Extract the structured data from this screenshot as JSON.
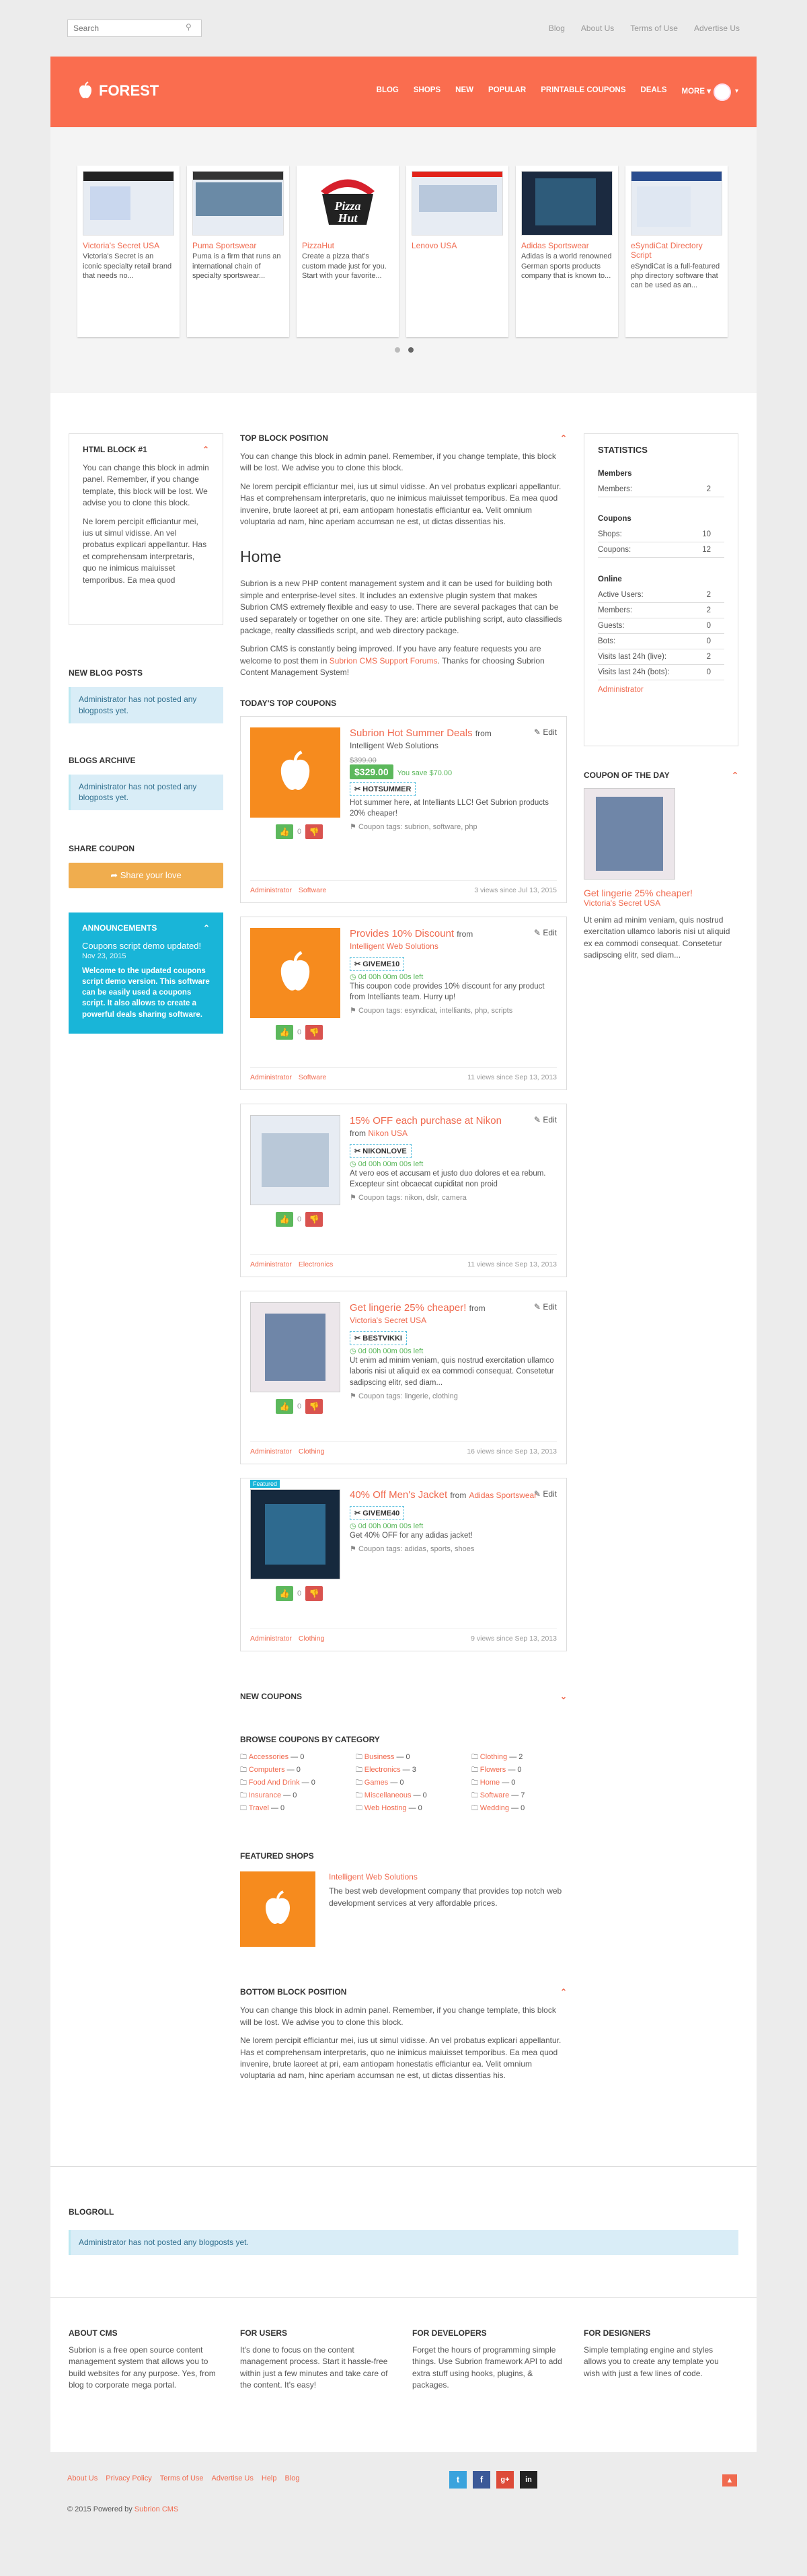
{
  "topbar": {
    "search_placeholder": "Search",
    "links": [
      "Blog",
      "About Us",
      "Terms of Use",
      "Advertise Us"
    ]
  },
  "header": {
    "logo": "FOREST",
    "nav": [
      "BLOG",
      "SHOPS",
      "NEW",
      "POPULAR",
      "PRINTABLE COUPONS",
      "DEALS",
      "MORE"
    ]
  },
  "carousel": {
    "cards": [
      {
        "title": "Victoria's Secret USA",
        "desc": "Victoria's Secret is an iconic specialty retail brand that needs no..."
      },
      {
        "title": "Puma Sportswear",
        "desc": "Puma is a firm that runs an international chain of specialty sportswear..."
      },
      {
        "title": "PizzaHut",
        "desc": "Create a pizza that's custom made just for you. Start with your favorite..."
      },
      {
        "title": "Lenovo USA",
        "desc": ""
      },
      {
        "title": "Adidas Sportswear",
        "desc": "Adidas is a world renowned German sports products company that is known to..."
      },
      {
        "title": "eSyndiCat Directory Script",
        "desc": "eSyndiCat is a full-featured php directory software that can be used as an..."
      }
    ]
  },
  "left": {
    "html_block_title": "HTML BLOCK #1",
    "html_block_p1": "You can change this block in admin panel. Remember, if you change template, this block will be lost. We advise you to clone this block.",
    "html_block_p2": "Ne lorem percipit efficiantur mei, ius ut simul vidisse. An vel probatus explicari appellantur. Has et comprehensam interpretaris, quo ne inimicus maiuisset temporibus. Ea mea quod",
    "new_blog_posts": "NEW BLOG POSTS",
    "no_posts": "Administrator has not posted any blogposts yet.",
    "blogs_archive": "BLOGS ARCHIVE",
    "share_coupon": "SHARE COUPON",
    "share_btn": "Share your love",
    "announcements": "ANNOUNCEMENTS",
    "ann_title": "Coupons script demo updated!",
    "ann_date": "Nov 23, 2015",
    "ann_body": "Welcome to the updated coupons script demo version. This software can be easily used a coupons script. It also allows to create a powerful deals sharing software."
  },
  "main": {
    "top_block_title": "TOP BLOCK POSITION",
    "top_block_p1": "You can change this block in admin panel. Remember, if you change template, this block will be lost. We advise you to clone this block.",
    "top_block_p2": "Ne lorem percipit efficiantur mei, ius ut simul vidisse. An vel probatus explicari appellantur. Has et comprehensam interpretaris, quo ne inimicus maiuisset temporibus. Ea mea quod invenire, brute laoreet at pri, eam antiopam honestatis efficiantur ea. Velit omnium voluptaria ad nam, hinc aperiam accumsan ne est, ut dictas dissentias his.",
    "home_title": "Home",
    "home_p1": "Subrion is a new PHP content management system and it can be used for building both simple and enterprise-level sites. It includes an extensive plugin system that makes Subrion CMS extremely flexible and easy to use. There are several packages that can be used separately or together on one site. They are: article publishing script, auto classifieds package, realty classifieds script, and web directory package.",
    "home_p2a": "Subrion CMS is constantly being improved. If you have any feature requests you are welcome to post them in",
    "home_p2link": "Subrion CMS Support Forums",
    "home_p2b": ". Thanks for choosing Subrion Content Management System!",
    "todays_top": "TODAY'S TOP COUPONS",
    "edit": "Edit",
    "coupons": [
      {
        "title": "Subrion Hot Summer Deals",
        "from": "from",
        "shop": "Intelligent Web Solutions",
        "old_price": "$399.00",
        "price": "$329.00",
        "save": "You save $70.00",
        "code": "HOTSUMMER",
        "timer": "",
        "desc": "Hot summer here, at Intelliants LLC! Get Subrion products 20% cheaper!",
        "tags": "Coupon tags: subrion, software, php",
        "votes": "0",
        "author": "Administrator",
        "cat": "Software",
        "meta": "3 views since Jul 13, 2015"
      },
      {
        "title": "Provides 10% Discount",
        "from": "from",
        "shop": "Intelligent Web Solutions",
        "code": "GIVEME10",
        "timer": "0d 00h 00m 00s left",
        "desc": "This coupon code provides 10% discount for any product from Intelliants team. Hurry up!",
        "tags": "Coupon tags: esyndicat, intelliants, php, scripts",
        "votes": "0",
        "author": "Administrator",
        "cat": "Software",
        "meta": "11 views since Sep 13, 2013"
      },
      {
        "title": "15% OFF each purchase at Nikon",
        "from": "from",
        "shop": "Nikon USA",
        "code": "NIKONLOVE",
        "timer": "0d 00h 00m 00s left",
        "desc": "At vero eos et accusam et justo duo dolores et ea rebum. Excepteur sint obcaecat cupiditat non proid",
        "tags": "Coupon tags: nikon, dslr, camera",
        "votes": "0",
        "author": "Administrator",
        "cat": "Electronics",
        "meta": "11 views since Sep 13, 2013"
      },
      {
        "title": "Get lingerie 25% cheaper!",
        "from": "from",
        "shop": "Victoria's Secret USA",
        "code": "BESTVIKKI",
        "timer": "0d 00h 00m 00s left",
        "desc": "Ut enim ad minim veniam, quis nostrud exercitation ullamco laboris nisi ut aliquid ex ea commodi consequat. Consetetur sadipscing elitr, sed diam...",
        "tags": "Coupon tags: lingerie, clothing",
        "votes": "0",
        "author": "Administrator",
        "cat": "Clothing",
        "meta": "16 views since Sep 13, 2013"
      },
      {
        "title": "40% Off Men's Jacket",
        "from": "from",
        "shop": "Adidas Sportswear",
        "badge": "Featured",
        "code": "GIVEME40",
        "timer": "0d 00h 00m 00s left",
        "desc": "Get 40% OFF for any adidas jacket!",
        "tags": "Coupon tags: adidas, sports, shoes",
        "votes": "0",
        "author": "Administrator",
        "cat": "Clothing",
        "meta": "9 views since Sep 13, 2013"
      }
    ],
    "new_coupons": "NEW COUPONS",
    "browse_cats": "BROWSE COUPONS BY CATEGORY",
    "categories": [
      {
        "n": "Accessories",
        "c": "— 0"
      },
      {
        "n": "Business",
        "c": "— 0"
      },
      {
        "n": "Clothing",
        "c": "— 2"
      },
      {
        "n": "Computers",
        "c": "— 0"
      },
      {
        "n": "Electronics",
        "c": "— 3"
      },
      {
        "n": "Flowers",
        "c": "— 0"
      },
      {
        "n": "Food And Drink",
        "c": "— 0"
      },
      {
        "n": "Games",
        "c": "— 0"
      },
      {
        "n": "Home",
        "c": "— 0"
      },
      {
        "n": "Insurance",
        "c": "— 0"
      },
      {
        "n": "Miscellaneous",
        "c": "— 0"
      },
      {
        "n": "Software",
        "c": "— 7"
      },
      {
        "n": "Travel",
        "c": "— 0"
      },
      {
        "n": "Web Hosting",
        "c": "— 0"
      },
      {
        "n": "Wedding",
        "c": "— 0"
      }
    ],
    "featured_shops": "FEATURED SHOPS",
    "fs_name": "Intelligent Web Solutions",
    "fs_desc": "The best web development company that provides top notch web development services at very affordable prices.",
    "bottom_block_title": "BOTTOM BLOCK POSITION",
    "bottom_block_p1": "You can change this block in admin panel. Remember, if you change template, this block will be lost. We advise you to clone this block.",
    "bottom_block_p2": "Ne lorem percipit efficiantur mei, ius ut simul vidisse. An vel probatus explicari appellantur. Has et comprehensam interpretaris, quo ne inimicus maiuisset temporibus. Ea mea quod invenire, brute laoreet at pri, eam antiopam honestatis efficiantur ea. Velit omnium voluptaria ad nam, hinc aperiam accumsan ne est, ut dictas dissentias his."
  },
  "right": {
    "stats_title": "STATISTICS",
    "members_h": "Members",
    "members": [
      [
        "Members:",
        "2"
      ]
    ],
    "coupons_h": "Coupons",
    "coupons": [
      [
        "Shops:",
        "10"
      ],
      [
        "Coupons:",
        "12"
      ]
    ],
    "online_h": "Online",
    "online": [
      [
        "Active Users:",
        "2"
      ],
      [
        "Members:",
        "2"
      ],
      [
        "Guests:",
        "0"
      ],
      [
        "Bots:",
        "0"
      ],
      [
        "Visits last 24h (live):",
        "2"
      ],
      [
        "Visits last 24h (bots):",
        "0"
      ]
    ],
    "admin": "Administrator",
    "cotd_title": "COUPON OF THE DAY",
    "cotd_name": "Get lingerie 25% cheaper!",
    "cotd_shop": "Victoria's Secret USA",
    "cotd_desc": "Ut enim ad minim veniam, quis nostrud exercitation ullamco laboris nisi ut aliquid ex ea commodi consequat. Consetetur sadipscing elitr, sed diam..."
  },
  "blogroll": {
    "title": "BLOGROLL",
    "text": "Administrator has not posted any blogposts yet."
  },
  "footer": {
    "cols": [
      {
        "h": "ABOUT CMS",
        "t": "Subrion is a free open source content management system that allows you to build websites for any purpose. Yes, from blog to corporate mega portal."
      },
      {
        "h": "FOR USERS",
        "t": "It's done to focus on the content management process. Start it hassle-free within just a few minutes and take care of the content. It's easy!"
      },
      {
        "h": "FOR DEVELOPERS",
        "t": "Forget the hours of programming simple things. Use Subrion framework API to add extra stuff using hooks, plugins, & packages."
      },
      {
        "h": "FOR DESIGNERS",
        "t": "Simple templating engine and styles allows you to create any template you wish with just a few lines of code."
      }
    ]
  },
  "bottom": {
    "links": [
      "About Us",
      "Privacy Policy",
      "Terms of Use",
      "Advertise Us",
      "Help",
      "Blog"
    ],
    "copy": "© 2015 Powered by",
    "copy_link": "Subrion CMS",
    "social": [
      "t",
      "f",
      "g+",
      "in"
    ]
  }
}
